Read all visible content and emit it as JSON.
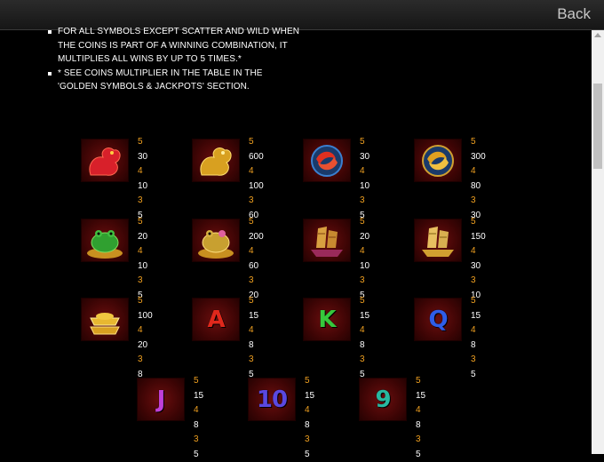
{
  "header": {
    "back_label": "Back"
  },
  "rules": [
    "For all symbols except scatter and wild when the coins is part of a winning combination, it multiplies all wins by up to 5 times.*",
    "* See coins multiplier in the table in the 'Golden symbols & jackpots' section."
  ],
  "paytable": [
    {
      "symbol": "red-dragon-icon",
      "pays": [
        [
          "5",
          "30"
        ],
        [
          "4",
          "10"
        ],
        [
          "3",
          "5"
        ]
      ]
    },
    {
      "symbol": "golden-dragon-icon",
      "pays": [
        [
          "5",
          "600"
        ],
        [
          "4",
          "100"
        ],
        [
          "3",
          "60"
        ]
      ]
    },
    {
      "symbol": "red-koi-icon",
      "pays": [
        [
          "5",
          "30"
        ],
        [
          "4",
          "10"
        ],
        [
          "3",
          "5"
        ]
      ]
    },
    {
      "symbol": "golden-koi-icon",
      "pays": [
        [
          "5",
          "300"
        ],
        [
          "4",
          "80"
        ],
        [
          "3",
          "30"
        ]
      ]
    },
    {
      "symbol": "green-frog-icon",
      "pays": [
        [
          "5",
          "20"
        ],
        [
          "4",
          "10"
        ],
        [
          "3",
          "5"
        ]
      ]
    },
    {
      "symbol": "golden-frog-icon",
      "pays": [
        [
          "5",
          "200"
        ],
        [
          "4",
          "60"
        ],
        [
          "3",
          "20"
        ]
      ]
    },
    {
      "symbol": "red-junk-ship-icon",
      "pays": [
        [
          "5",
          "20"
        ],
        [
          "4",
          "10"
        ],
        [
          "3",
          "5"
        ]
      ]
    },
    {
      "symbol": "golden-junk-ship-icon",
      "pays": [
        [
          "5",
          "150"
        ],
        [
          "4",
          "30"
        ],
        [
          "3",
          "10"
        ]
      ]
    },
    {
      "symbol": "gold-ingot-icon",
      "pays": [
        [
          "5",
          "100"
        ],
        [
          "4",
          "20"
        ],
        [
          "3",
          "8"
        ]
      ]
    },
    {
      "symbol": "letter-a-icon",
      "glyph": "A",
      "color": "#e0281c",
      "pays": [
        [
          "5",
          "15"
        ],
        [
          "4",
          "8"
        ],
        [
          "3",
          "5"
        ]
      ]
    },
    {
      "symbol": "letter-k-icon",
      "glyph": "K",
      "color": "#36c83c",
      "pays": [
        [
          "5",
          "15"
        ],
        [
          "4",
          "8"
        ],
        [
          "3",
          "5"
        ]
      ]
    },
    {
      "symbol": "letter-q-icon",
      "glyph": "Q",
      "color": "#2f5de8",
      "pays": [
        [
          "5",
          "15"
        ],
        [
          "4",
          "8"
        ],
        [
          "3",
          "5"
        ]
      ]
    },
    {
      "symbol": "letter-j-icon",
      "glyph": "J",
      "color": "#c040d8",
      "pays": [
        [
          "5",
          "15"
        ],
        [
          "4",
          "8"
        ],
        [
          "3",
          "5"
        ]
      ]
    },
    {
      "symbol": "number-10-icon",
      "glyph": "10",
      "color": "#5a48e0",
      "pays": [
        [
          "5",
          "15"
        ],
        [
          "4",
          "8"
        ],
        [
          "3",
          "5"
        ]
      ]
    },
    {
      "symbol": "number-9-icon",
      "glyph": "9",
      "color": "#28b8a0",
      "pays": [
        [
          "5",
          "15"
        ],
        [
          "4",
          "8"
        ],
        [
          "3",
          "5"
        ]
      ]
    }
  ]
}
